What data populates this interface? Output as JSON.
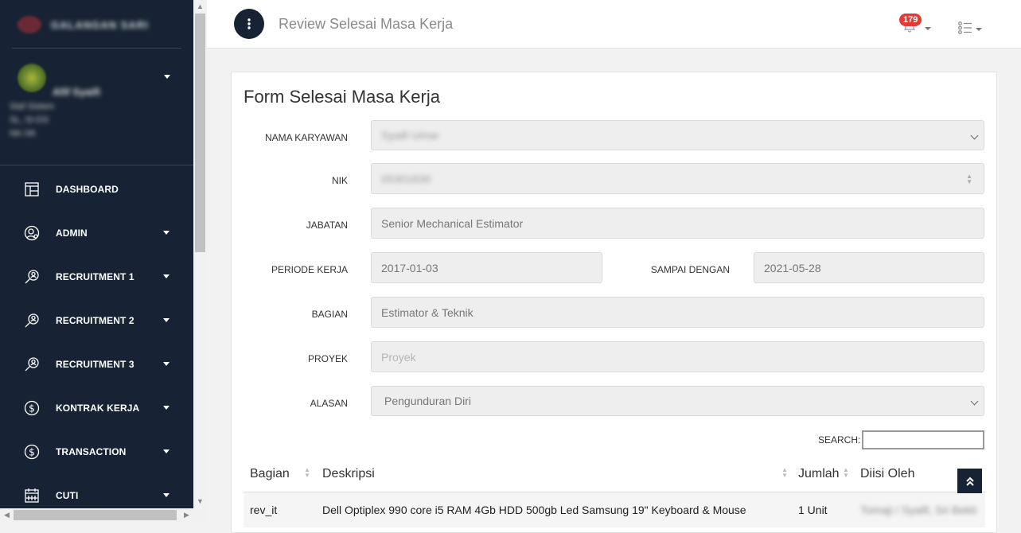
{
  "sidebar": {
    "brand_name": "GALANGAN SARI",
    "user": {
      "name": "Afif Syaifi",
      "detail_1": "Staf Sistem",
      "detail_2": "SL, SI-DS",
      "detail_3": "NK-SK"
    },
    "items": [
      {
        "label": "DASHBOARD",
        "icon": "dashboard-icon",
        "has_caret": false
      },
      {
        "label": "ADMIN",
        "icon": "user-gear-icon",
        "has_caret": true
      },
      {
        "label": "RECRUITMENT 1",
        "icon": "search-person-icon",
        "has_caret": true
      },
      {
        "label": "RECRUITMENT 2",
        "icon": "search-person-icon",
        "has_caret": true
      },
      {
        "label": "RECRUITMENT 3",
        "icon": "search-person-icon",
        "has_caret": true
      },
      {
        "label": "KONTRAK KERJA",
        "icon": "dollar-circle-icon",
        "has_caret": true
      },
      {
        "label": "TRANSACTION",
        "icon": "dollar-circle-icon",
        "has_caret": true
      },
      {
        "label": "CUTI",
        "icon": "calendar-icon",
        "has_caret": true
      }
    ]
  },
  "topbar": {
    "title": "Review Selesai Masa Kerja",
    "notification_count": "179"
  },
  "form": {
    "title": "Form Selesai Masa Kerja",
    "nama_karyawan": {
      "label": "NAMA KARYAWAN",
      "value": "Syaifi Umar"
    },
    "nik": {
      "label": "NIK",
      "value": "05301830"
    },
    "jabatan": {
      "label": "JABATAN",
      "value": "Senior Mechanical Estimator"
    },
    "periode": {
      "label": "PERIODE KERJA",
      "value": "2017-01-03"
    },
    "sampai": {
      "label": "SAMPAI DENGAN",
      "value": "2021-05-28"
    },
    "bagian": {
      "label": "BAGIAN",
      "value": "Estimator & Teknik"
    },
    "proyek": {
      "label": "PROYEK",
      "placeholder": "Proyek"
    },
    "alasan": {
      "label": "ALASAN",
      "value": "Pengunduran Diri"
    }
  },
  "table": {
    "search_label": "SEARCH:",
    "search_value": "",
    "columns": [
      "Bagian",
      "Deskripsi",
      "Jumlah",
      "Diisi Oleh"
    ],
    "rows": [
      {
        "bagian": "rev_it",
        "deskripsi": "Dell Optiplex 990 core i5 RAM 4Gb HDD 500gb Led Samsung 19\" Keyboard & Mouse",
        "jumlah": "1 Unit",
        "diisi_oleh": "Tomaji / Syaifi, Sri Bekti"
      }
    ]
  }
}
